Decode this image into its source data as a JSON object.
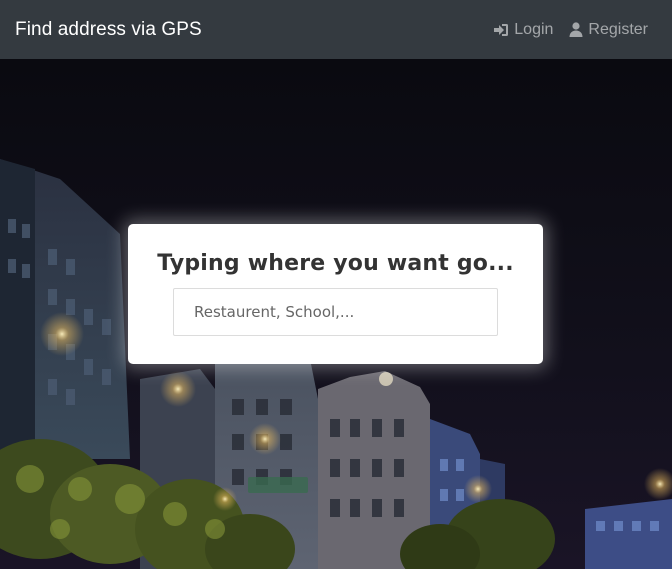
{
  "navbar": {
    "brand": "Find address via GPS",
    "login_label": "Login",
    "register_label": "Register"
  },
  "search": {
    "title": "Typing where you want go...",
    "placeholder": "Restaurent, School,..."
  },
  "icons": {
    "login": "sign-in-icon",
    "register": "user-icon"
  },
  "colors": {
    "navbar": "#343a40",
    "card": "#ffffff"
  }
}
